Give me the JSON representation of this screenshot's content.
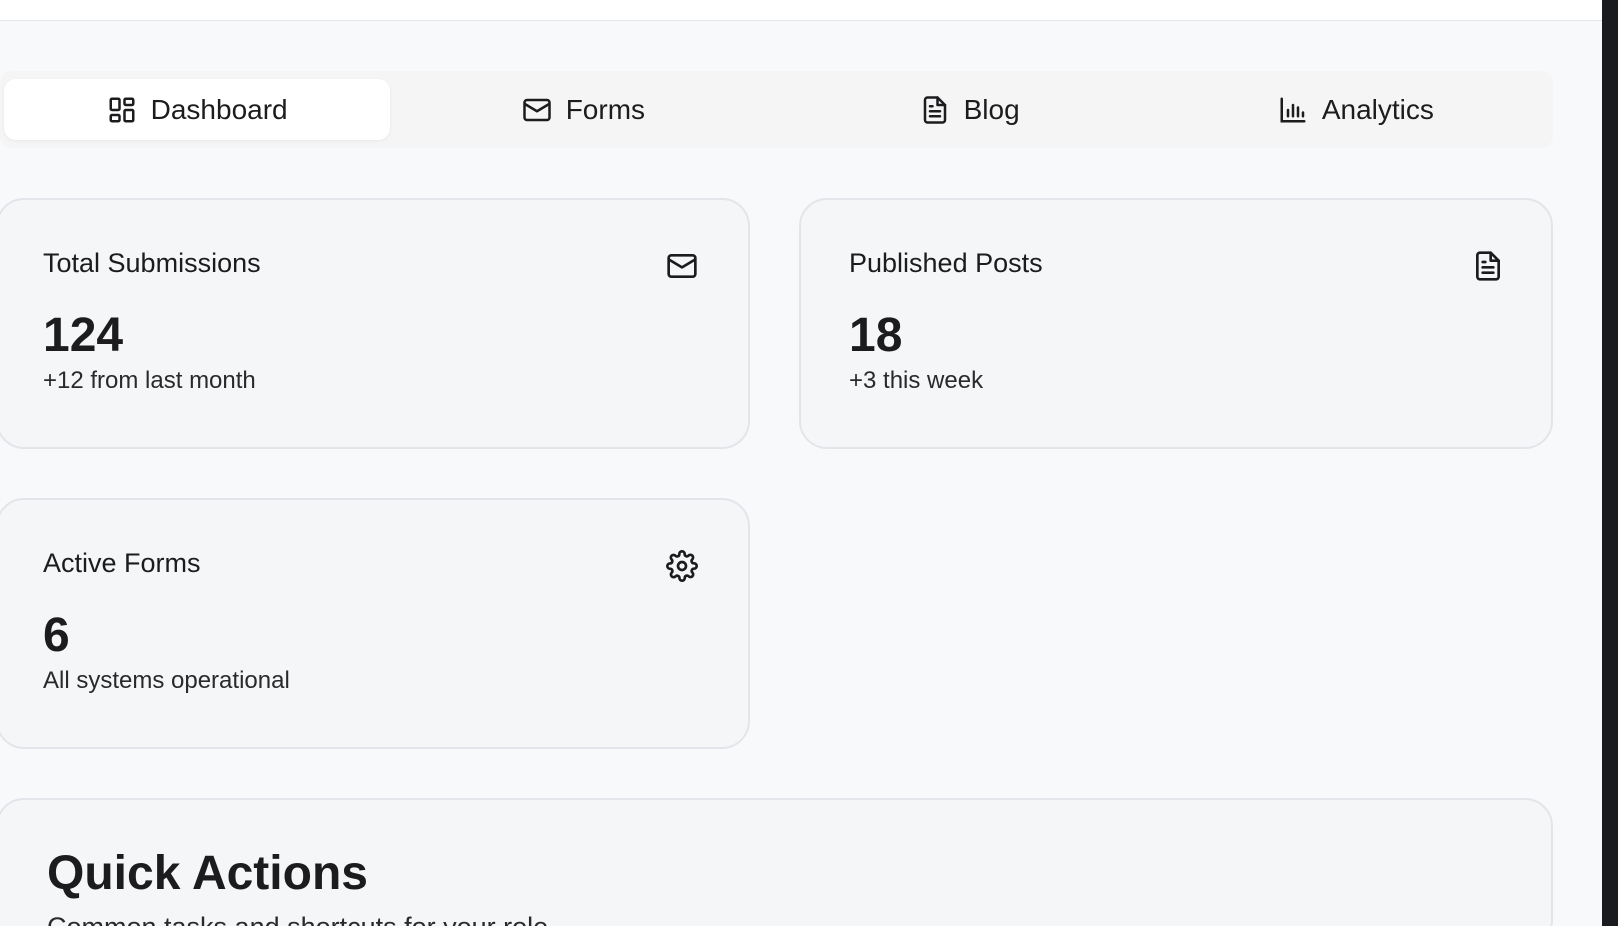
{
  "tabs": [
    {
      "label": "Dashboard",
      "icon": "dashboard-grid-icon",
      "active": true
    },
    {
      "label": "Forms",
      "icon": "mail-icon",
      "active": false
    },
    {
      "label": "Blog",
      "icon": "document-icon",
      "active": false
    },
    {
      "label": "Analytics",
      "icon": "bar-chart-icon",
      "active": false
    }
  ],
  "stats": {
    "submissions": {
      "title": "Total Submissions",
      "value": "124",
      "sub": "+12 from last month",
      "icon": "mail-icon"
    },
    "posts": {
      "title": "Published Posts",
      "value": "18",
      "sub": "+3 this week",
      "icon": "document-icon"
    },
    "forms": {
      "title": "Active Forms",
      "value": "6",
      "sub": "All systems operational",
      "icon": "gear-icon"
    }
  },
  "quick_actions": {
    "title": "Quick Actions",
    "subtitle": "Common tasks and shortcuts for your role"
  }
}
